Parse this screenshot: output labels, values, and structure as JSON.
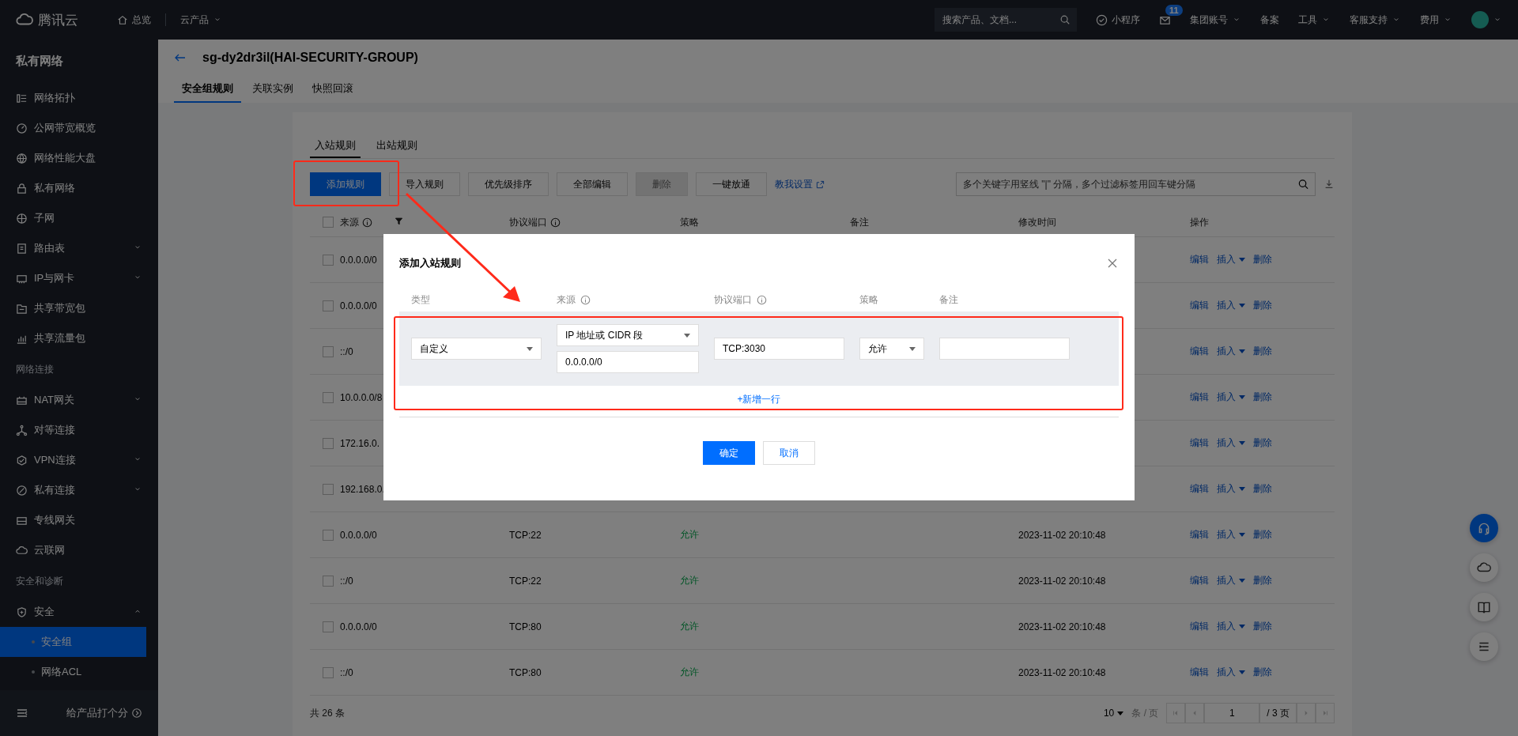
{
  "top_bar": {
    "brand": "腾讯云",
    "overview": "总览",
    "products": {
      "label": "云产品",
      "dropdown": true
    },
    "search": {
      "placeholder": "搜索产品、文档..."
    },
    "mini_program": "小程序",
    "mail_badge": "11",
    "menus": [
      {
        "label": "集团账号",
        "dropdown": true
      },
      {
        "label": "备案",
        "dropdown": false
      },
      {
        "label": "工具",
        "dropdown": true
      },
      {
        "label": "客服支持",
        "dropdown": true
      },
      {
        "label": "费用",
        "dropdown": true
      }
    ]
  },
  "sidebar": {
    "title": "私有网络",
    "groups": [
      {
        "items": [
          {
            "label": "网络拓扑",
            "selected": false
          },
          {
            "label": "公网带宽概览",
            "selected": false
          },
          {
            "label": "网络性能大盘",
            "selected": false
          },
          {
            "label": "私有网络",
            "selected": false
          },
          {
            "label": "子网",
            "selected": false
          },
          {
            "label": "路由表",
            "selected": false,
            "expanded": false
          },
          {
            "label": "IP与网卡",
            "selected": false,
            "expanded": false
          },
          {
            "label": "共享带宽包",
            "selected": false
          },
          {
            "label": "共享流量包",
            "selected": false
          }
        ]
      },
      {
        "heading": "网络连接",
        "items": [
          {
            "label": "NAT网关",
            "selected": false,
            "expanded": false
          },
          {
            "label": "对等连接",
            "selected": false
          },
          {
            "label": "VPN连接",
            "selected": false,
            "expanded": false
          },
          {
            "label": "私有连接",
            "selected": false,
            "expanded": false
          },
          {
            "label": "专线网关",
            "selected": false
          },
          {
            "label": "云联网",
            "selected": false
          }
        ]
      },
      {
        "heading": "安全和诊断",
        "items": [
          {
            "label": "安全",
            "selected": false,
            "expanded": true,
            "children": [
              {
                "label": "安全组",
                "selected": true
              },
              {
                "label": "网络ACL",
                "selected": false
              }
            ]
          }
        ]
      }
    ],
    "feedback": "给产品打个分"
  },
  "page": {
    "title": "sg-dy2dr3il(HAI-SECURITY-GROUP)",
    "tabs": [
      {
        "label": "安全组规则",
        "selected": true
      },
      {
        "label": "关联实例",
        "selected": false
      },
      {
        "label": "快照回滚",
        "selected": false
      }
    ]
  },
  "rules": {
    "tabs": [
      {
        "label": "入站规则",
        "selected": true
      },
      {
        "label": "出站规则",
        "selected": false
      }
    ],
    "toolbar": [
      {
        "label": "添加规则",
        "kind": "primary",
        "disabled": false
      },
      {
        "label": "导入规则",
        "kind": "default",
        "disabled": false
      },
      {
        "label": "优先级排序",
        "kind": "default",
        "disabled": false
      },
      {
        "label": "全部编辑",
        "kind": "default",
        "disabled": false
      },
      {
        "label": "删除",
        "kind": "default",
        "disabled": true
      },
      {
        "label": "一键放通",
        "kind": "default",
        "disabled": false
      }
    ],
    "help_link": "教我设置",
    "search": {
      "placeholder": "多个关键字用竖线 \"|\" 分隔，多个过滤标签用回车键分隔"
    },
    "columns": [
      "来源",
      "协议端口",
      "策略",
      "备注",
      "修改时间",
      "操作"
    ],
    "all_checked": false,
    "rows": [
      {
        "checked": false,
        "source": "0.0.0.0/0",
        "actions": [
          "编辑",
          "插入",
          "删除"
        ]
      },
      {
        "checked": false,
        "source": "0.0.0.0/0",
        "actions": [
          "编辑",
          "插入",
          "删除"
        ]
      },
      {
        "checked": false,
        "source": "::/0",
        "actions": [
          "编辑",
          "插入",
          "删除"
        ]
      },
      {
        "checked": false,
        "source": "10.0.0.0/8",
        "actions": [
          "编辑",
          "插入",
          "删除"
        ]
      },
      {
        "checked": false,
        "source": "172.16.0.",
        "actions": [
          "编辑",
          "插入",
          "删除"
        ]
      },
      {
        "checked": false,
        "source": "192.168.0.",
        "actions": [
          "编辑",
          "插入",
          "删除"
        ]
      },
      {
        "checked": false,
        "source": "0.0.0.0/0",
        "port": "TCP:22",
        "policy": "允许",
        "modified": "2023-11-02 20:10:48",
        "actions": [
          "编辑",
          "插入",
          "删除"
        ]
      },
      {
        "checked": false,
        "source": "::/0",
        "port": "TCP:22",
        "policy": "允许",
        "modified": "2023-11-02 20:10:48",
        "actions": [
          "编辑",
          "插入",
          "删除"
        ]
      },
      {
        "checked": false,
        "source": "0.0.0.0/0",
        "port": "TCP:80",
        "policy": "允许",
        "modified": "2023-11-02 20:10:48",
        "actions": [
          "编辑",
          "插入",
          "删除"
        ]
      },
      {
        "checked": false,
        "source": "::/0",
        "port": "TCP:80",
        "policy": "允许",
        "modified": "2023-11-02 20:10:48",
        "actions": [
          "编辑",
          "插入",
          "删除"
        ]
      }
    ],
    "footer": {
      "total": "共 26 条",
      "page_size": "10",
      "page_size_unit": "条 / 页",
      "page": "1",
      "pages": "/ 3 页"
    }
  },
  "dialog": {
    "title": "添加入站规则",
    "columns": [
      "类型",
      "来源",
      "协议端口",
      "策略",
      "备注"
    ],
    "row": {
      "type": "自定义",
      "source_kind": "IP 地址或 CIDR 段",
      "source": "0.0.0.0/0",
      "port": "TCP:3030",
      "policy": "允许"
    },
    "add_row": "+新增一行",
    "buttons": [
      {
        "label": "确定",
        "kind": "primary"
      },
      {
        "label": "取消",
        "kind": "default"
      }
    ]
  }
}
